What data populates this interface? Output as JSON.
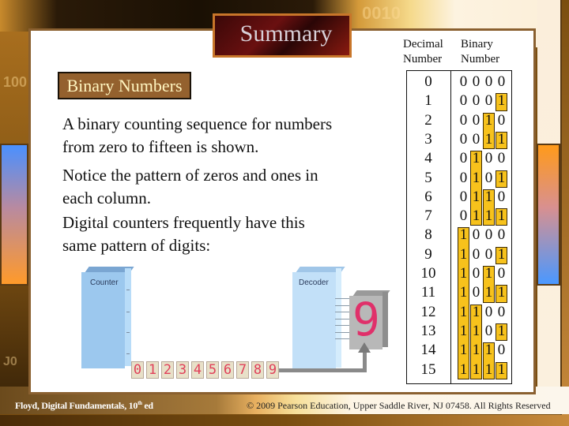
{
  "slide": {
    "title": "Summary",
    "subheading": "Binary Numbers",
    "paragraphs": [
      [
        "A binary counting sequence for numbers",
        "from zero to fifteen is shown."
      ],
      [
        "Notice the pattern of zeros and ones in",
        "each column."
      ],
      [
        "Digital counters frequently have this",
        "same pattern of digits:"
      ]
    ]
  },
  "table": {
    "header_decimal": [
      "Decimal",
      "Number"
    ],
    "header_binary": [
      "Binary",
      "Number"
    ],
    "rows": [
      {
        "decimal": "0",
        "binary": "0000"
      },
      {
        "decimal": "1",
        "binary": "0001"
      },
      {
        "decimal": "2",
        "binary": "0010"
      },
      {
        "decimal": "3",
        "binary": "0011"
      },
      {
        "decimal": "4",
        "binary": "0100"
      },
      {
        "decimal": "5",
        "binary": "0101"
      },
      {
        "decimal": "6",
        "binary": "0110"
      },
      {
        "decimal": "7",
        "binary": "0111"
      },
      {
        "decimal": "8",
        "binary": "1000"
      },
      {
        "decimal": "9",
        "binary": "1001"
      },
      {
        "decimal": "10",
        "binary": "1010"
      },
      {
        "decimal": "11",
        "binary": "1011"
      },
      {
        "decimal": "12",
        "binary": "1100"
      },
      {
        "decimal": "13",
        "binary": "1101"
      },
      {
        "decimal": "14",
        "binary": "1110"
      },
      {
        "decimal": "15",
        "binary": "1111"
      }
    ],
    "highlight_color": "#f7c21c"
  },
  "diagram": {
    "counter_label": "Counter",
    "decoder_label": "Decoder",
    "display_digit": "9",
    "sequence_digits": [
      "0",
      "1",
      "2",
      "3",
      "4",
      "5",
      "6",
      "7",
      "8",
      "9"
    ],
    "segment_color": "#e0306a"
  },
  "background": {
    "digits_top": "0010",
    "digits_left": "100",
    "digits_left_low": "J0"
  },
  "footer": {
    "left_prefix": "Floyd, Digital Fundamentals, 10",
    "left_sup": "th",
    "left_suffix": " ed",
    "right": "© 2009 Pearson Education, Upper Saddle River, NJ 07458. All Rights Reserved"
  }
}
